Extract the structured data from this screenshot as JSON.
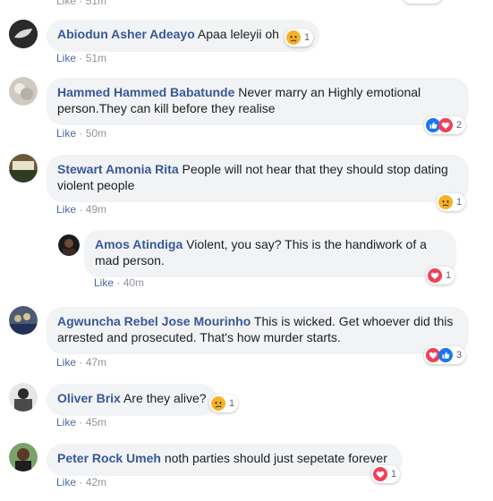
{
  "top_partial": {
    "like_label": "Like",
    "time": "51m"
  },
  "comments": [
    {
      "author": "Abiodun Asher Adeayo",
      "text": "Apaa leleyii oh",
      "like_label": "Like",
      "time": "51m",
      "reactions": [
        "sad-icon"
      ],
      "reaction_count": "1",
      "avatar_color": "#2b2b2b"
    },
    {
      "author": "Hammed Hammed Babatunde",
      "text": "Never marry an Highly emotional person.They can kill before they realise",
      "like_label": "Like",
      "time": "50m",
      "reactions": [
        "like-icon",
        "love-icon"
      ],
      "reaction_count": "2",
      "avatar_color": "#cfc9c1"
    },
    {
      "author": "Stewart Amonia Rita",
      "text": "People will not hear that they should stop dating violent people",
      "like_label": "Like",
      "time": "49m",
      "reactions": [
        "sad-icon"
      ],
      "reaction_count": "1",
      "avatar_color": "#6a5a3a"
    },
    {
      "author": "Amos Atindiga",
      "text": "Violent, you say? This is the handiwork of a mad person.",
      "like_label": "Like",
      "time": "40m",
      "reactions": [
        "love-icon"
      ],
      "reaction_count": "1",
      "avatar_color": "#3b2a22"
    },
    {
      "author": "Agwuncha Rebel Jose Mourinho",
      "text": "This is wicked. Get whoever did this arrested and prosecuted. That's how murder starts.",
      "like_label": "Like",
      "time": "47m",
      "reactions": [
        "love-icon",
        "like-icon"
      ],
      "reaction_count": "3",
      "avatar_color": "#4d5a73"
    },
    {
      "author": "Oliver Brix",
      "text": "Are they alive?",
      "like_label": "Like",
      "time": "45m",
      "reactions": [
        "sad-icon"
      ],
      "reaction_count": "1",
      "avatar_color": "#7a7a7a"
    },
    {
      "author": "Peter Rock Umeh",
      "text": "noth parties should just sepetate forever",
      "like_label": "Like",
      "time": "42m",
      "reactions": [
        "love-icon"
      ],
      "reaction_count": "1",
      "avatar_color": "#5a3a25"
    }
  ],
  "colors": {
    "author": "#385898",
    "bubble": "#f2f3f5",
    "meta": "#90949c",
    "like_blue": "#1877f2",
    "love_red": "#f33e58",
    "sad_yellow": "#f7b125"
  }
}
